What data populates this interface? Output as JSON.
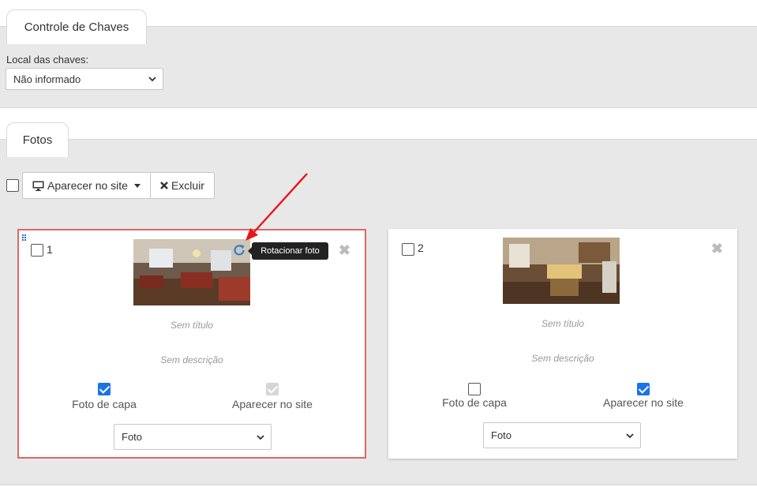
{
  "sections": {
    "chaves": {
      "tab_label": "Controle de Chaves"
    },
    "fotos": {
      "tab_label": "Fotos"
    }
  },
  "local": {
    "label": "Local das chaves:",
    "selected": "Não informado"
  },
  "toolbar": {
    "show_on_site_label": "Aparecer no site",
    "delete_label": "Excluir",
    "show_icon": "monitor-icon",
    "delete_icon": "times-icon"
  },
  "tooltip": {
    "text": "Rotacionar foto"
  },
  "photos": [
    {
      "number": "1",
      "title_placeholder": "Sem título",
      "description_placeholder": "Sem descrição",
      "cover_label": "Foto de capa",
      "cover_checked": true,
      "site_label": "Aparecer no site",
      "site_checked": true,
      "site_disabled": true,
      "type": "Foto",
      "selected_card": true
    },
    {
      "number": "2",
      "title_placeholder": "Sem título",
      "description_placeholder": "Sem descrição",
      "cover_label": "Foto de capa",
      "cover_checked": false,
      "site_label": "Aparecer no site",
      "site_checked": true,
      "site_disabled": false,
      "type": "Foto",
      "selected_card": false
    }
  ],
  "colors": {
    "accent": "#1a73e8",
    "selected_border": "#e06666",
    "annotation_arrow": "#e8161b",
    "band": "#e8e8e8"
  }
}
